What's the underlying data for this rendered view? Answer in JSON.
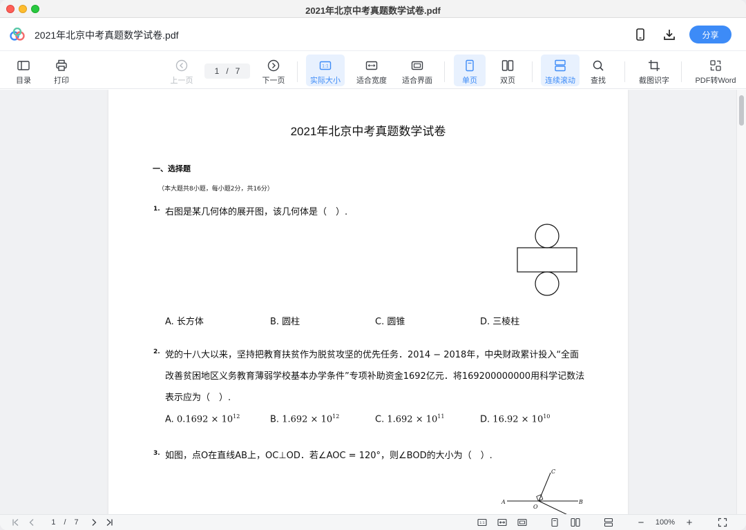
{
  "window": {
    "title": "2021年北京中考真题数学试卷.pdf"
  },
  "header": {
    "doc_title": "2021年北京中考真题数学试卷.pdf",
    "share_label": "分享",
    "icons": [
      "phone-icon",
      "download-icon"
    ]
  },
  "toolbar": {
    "toc": "目录",
    "print": "打印",
    "prev": "上一页",
    "page_current": "1",
    "page_sep": "/",
    "page_total": "7",
    "next": "下一页",
    "actual_size": "实际大小",
    "fit_width": "适合宽度",
    "fit_page": "适合界面",
    "single": "单页",
    "double": "双页",
    "continuous": "连续滚动",
    "find": "查找",
    "ocr": "截图识字",
    "to_word": "PDF转Word"
  },
  "paper": {
    "title": "2021年北京中考真题数学试卷",
    "section": "一、选择题",
    "section_note": "（本大题共8小题，每小题2分，共16分）",
    "q1": {
      "num": "1.",
      "text": "右图是某几何体的展开图，该几何体是（　）.",
      "options": [
        "A. 长方体",
        "B. 圆柱",
        "C. 圆锥",
        "D. 三棱柱"
      ]
    },
    "q2": {
      "num": "2.",
      "line1": "党的十八大以来，坚持把教育扶贫作为脱贫攻坚的优先任务．2014 − 2018年，中央财政累计投入“全面",
      "line2": "改善贫困地区义务教育薄弱学校基本办学条件”专项补助资金1692亿元．将169200000000用科学记数法",
      "line3": "表示应为（　）.",
      "options": [
        {
          "label": "A.",
          "base": "0.1692 × 10",
          "exp": "12"
        },
        {
          "label": "B.",
          "base": "1.692 × 10",
          "exp": "12"
        },
        {
          "label": "C.",
          "base": "1.692 × 10",
          "exp": "11"
        },
        {
          "label": "D.",
          "base": "16.92 × 10",
          "exp": "10"
        }
      ]
    },
    "q3": {
      "num": "3.",
      "text": "如图，点O在直线AB上，OC⊥OD．若∠AOC = 120°，则∠BOD的大小为（　）.",
      "fig_labels": {
        "a": "A",
        "b": "B",
        "c": "C",
        "o": "O"
      }
    }
  },
  "statusbar": {
    "page_current": "1",
    "page_sep": "/",
    "page_total": "7",
    "zoom": "100%",
    "minus": "−",
    "plus": "+"
  },
  "colors": {
    "accent": "#3d8bf7",
    "active_bg": "#e8f1fe"
  }
}
